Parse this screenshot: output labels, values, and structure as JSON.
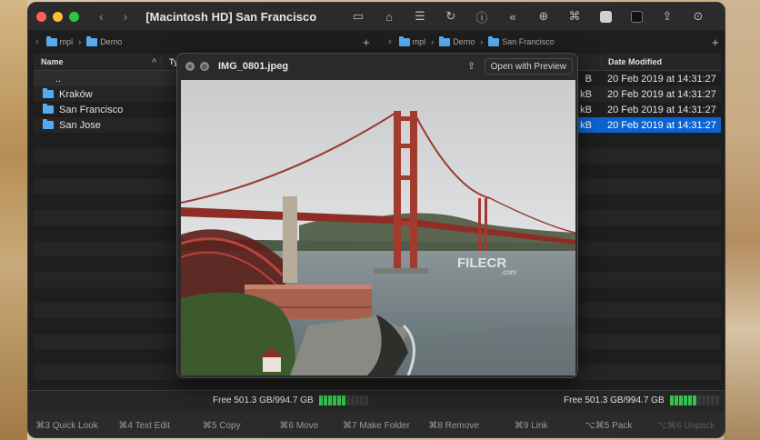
{
  "window": {
    "title": "[Macintosh HD] San Francisco"
  },
  "toolbar": {
    "icons": [
      "display-icon",
      "home-icon",
      "list-icon",
      "refresh-icon",
      "info-icon",
      "rewind-icon",
      "globe-icon",
      "network-icon",
      "appearance-light-icon",
      "terminal-icon",
      "share-icon",
      "download-icon"
    ]
  },
  "left_path": {
    "crumbs": [
      "mpl",
      "Demo"
    ]
  },
  "right_path": {
    "crumbs": [
      "mpl",
      "Demo",
      "San Francisco"
    ]
  },
  "left_panel": {
    "col_name": "Name",
    "col_type": "Type",
    "rows": [
      {
        "name": ".."
      },
      {
        "name": "Kraków"
      },
      {
        "name": "San Francisco"
      },
      {
        "name": "San Jose"
      }
    ]
  },
  "right_panel": {
    "col_date": "Date Modified",
    "rows": [
      {
        "size": "B",
        "date": "20 Feb 2019 at 14:31:27"
      },
      {
        "size": "kB",
        "date": "20 Feb 2019 at 14:31:27"
      },
      {
        "size": "kB",
        "date": "20 Feb 2019 at 14:31:27"
      },
      {
        "size": "kB",
        "date": "20 Feb 2019 at 14:31:27",
        "selected": true
      }
    ]
  },
  "free_space": {
    "left": "Free 501.3 GB/994.7 GB",
    "right": "Free 501.3 GB/994.7 GB",
    "used_fraction": 0.5
  },
  "function_keys": [
    {
      "label": "⌘3 Quick Look"
    },
    {
      "label": "⌘4 Text Edit"
    },
    {
      "label": "⌘5 Copy"
    },
    {
      "label": "⌘6 Move"
    },
    {
      "label": "⌘7 Make Folder"
    },
    {
      "label": "⌘8 Remove"
    },
    {
      "label": "⌘9 Link"
    },
    {
      "label": "⌥⌘5 Pack"
    },
    {
      "label": "⌥⌘6 Unpack",
      "disabled": true
    }
  ],
  "quick_look": {
    "filename": "IMG_0801.jpeg",
    "open_button": "Open with Preview"
  },
  "watermark": {
    "text": "FILECR",
    "sub": ".com"
  },
  "colors": {
    "accent": "#0b63d0",
    "folder": "#56aaf0",
    "meter": "#35c44e"
  }
}
